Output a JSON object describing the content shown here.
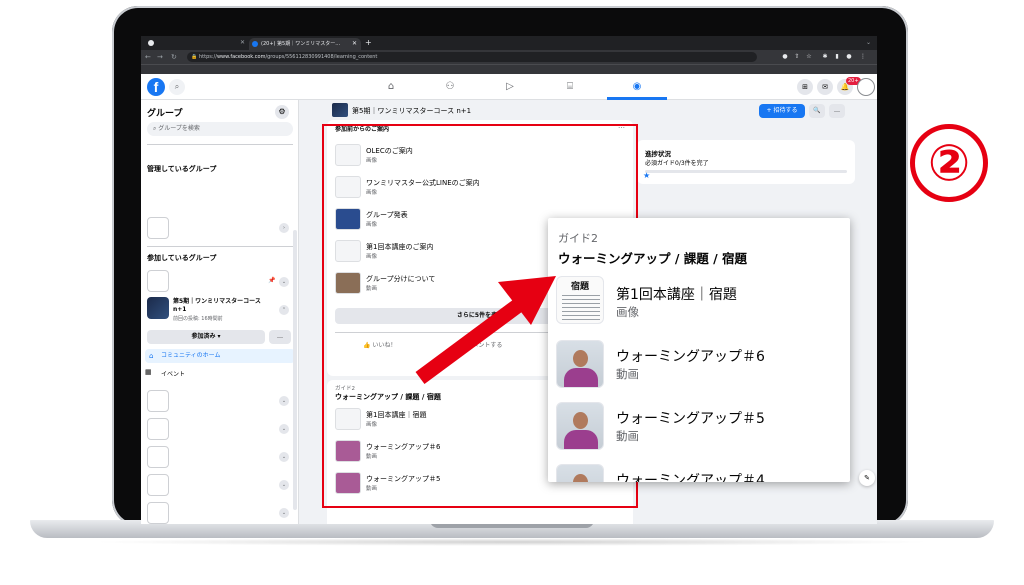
{
  "browser": {
    "tab_title": "(20+) 第5期｜ワンミリマスター…",
    "url_prefix": "https://",
    "url_host": "www.facebook.com",
    "url_path": "/groups/556112830991408/learning_content"
  },
  "fb": {
    "notification_count": "20+"
  },
  "sidebar": {
    "title": "グループ",
    "search_placeholder": "グループを検索",
    "managing_heading": "管理しているグループ",
    "joined_heading": "参加しているグループ",
    "group_name": "第5期｜ワンミリマスターコース n+1",
    "group_last_active": "前回の投稿: 16時間前",
    "joined_button": "参加済み ▾",
    "more_button": "…",
    "community_home": "コミュニティのホーム",
    "events": "イベント"
  },
  "header": {
    "group_title": "第5期｜ワンミリマスターコース n+1",
    "invite_button": "+ 招待する",
    "search_icon": "🔍",
    "more_icon": "…"
  },
  "card": {
    "heading": "参加前からのご案内",
    "items": [
      {
        "title": "OLECのご案内",
        "type": "画像"
      },
      {
        "title": "ワンミリマスター公式LINEのご案内",
        "type": "画像"
      },
      {
        "title": "グループ発表",
        "type": "画像"
      },
      {
        "title": "第1回本講座のご案内",
        "type": "画像"
      },
      {
        "title": "グループ分けについて",
        "type": "動画"
      }
    ],
    "see_more": "さらに5件を表示",
    "like": "いいね！",
    "comment": "コメントする"
  },
  "card2": {
    "guide_label": "ガイド2",
    "title": "ウォーミングアップ / 課題 / 宿題",
    "items": [
      {
        "title": "第1回本講座｜宿題",
        "type": "画像"
      },
      {
        "title": "ウォーミングアップ＃6",
        "type": "動画"
      },
      {
        "title": "ウォーミングアップ＃5",
        "type": "動画"
      }
    ]
  },
  "progress": {
    "title": "進捗状況",
    "subtitle": "必須ガイド0/3件を完了",
    "completed": 0,
    "total": 3
  },
  "zoom": {
    "guide_label": "ガイド2",
    "title": "ウォーミングアップ / 課題 / 宿題",
    "doc_heading": "宿題",
    "items": [
      {
        "title": "第1回本講座｜宿題",
        "type": "画像"
      },
      {
        "title": "ウォーミングアップ＃6",
        "type": "動画"
      },
      {
        "title": "ウォーミングアップ＃5",
        "type": "動画"
      },
      {
        "title": "ウォーミングアップ＃4",
        "type": ""
      }
    ]
  },
  "annotation": {
    "step_number": "②",
    "highlight_color": "#e60012"
  },
  "colors": {
    "fb_blue": "#1877f2",
    "annotation_red": "#e60012"
  }
}
